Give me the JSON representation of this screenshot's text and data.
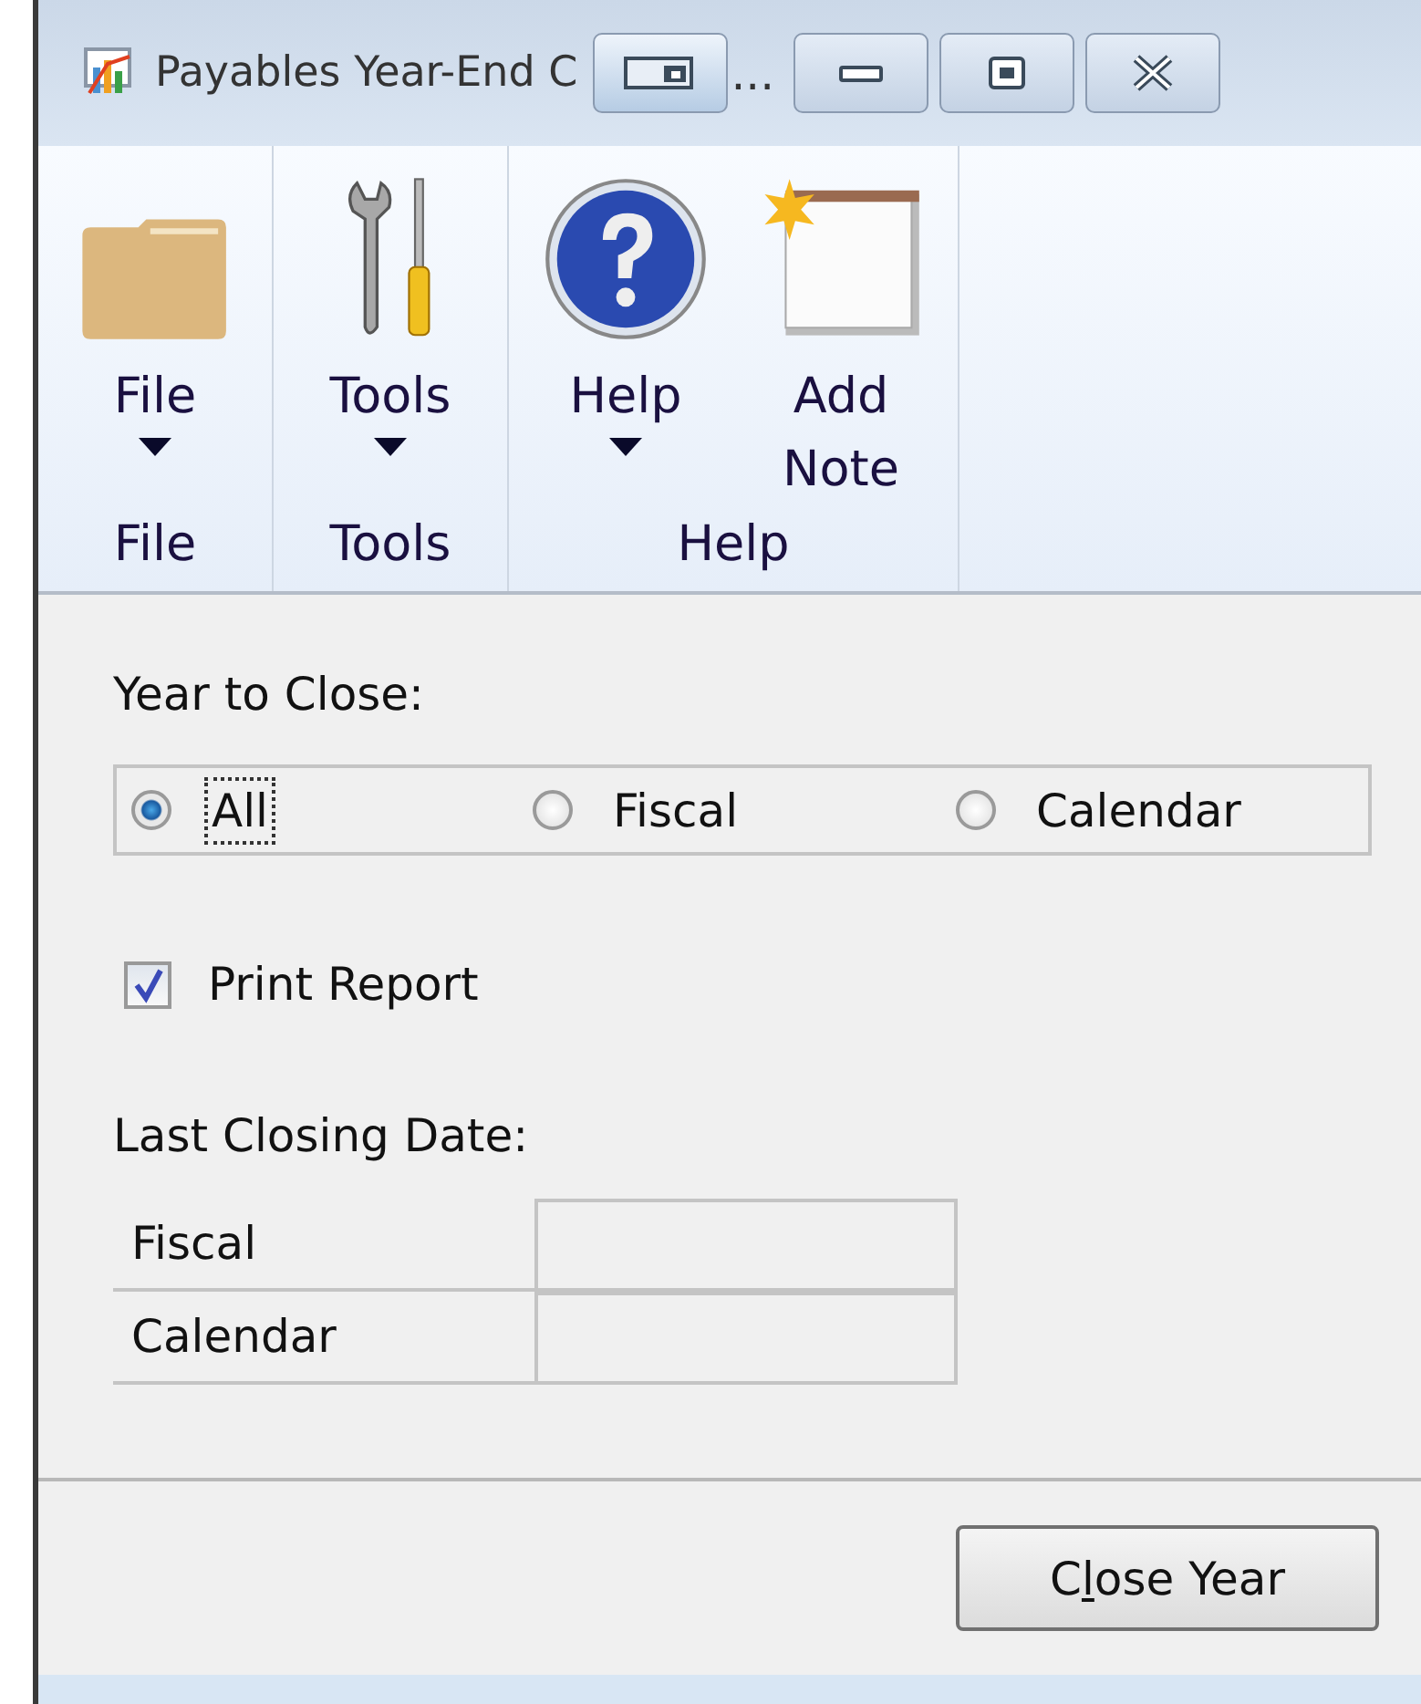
{
  "window": {
    "title": "Payables Year-End C",
    "title_tail": "..."
  },
  "ribbon": {
    "groups": [
      {
        "label": "File",
        "items": [
          {
            "kind": "folder",
            "label": "File",
            "dropdown": true
          }
        ]
      },
      {
        "label": "Tools",
        "items": [
          {
            "kind": "tools",
            "label": "Tools",
            "dropdown": true
          }
        ]
      },
      {
        "label": "Help",
        "items": [
          {
            "kind": "help",
            "label": "Help",
            "dropdown": true
          },
          {
            "kind": "note",
            "label": "Add Note",
            "dropdown": false
          }
        ]
      }
    ]
  },
  "year_to_close": {
    "label": "Year to Close:",
    "options": [
      {
        "label": "All",
        "selected": true
      },
      {
        "label": "Fiscal",
        "selected": false
      },
      {
        "label": "Calendar",
        "selected": false
      }
    ]
  },
  "print_report": {
    "label": "Print Report",
    "checked": true
  },
  "last_closing_date": {
    "label": "Last Closing Date:",
    "rows": [
      {
        "label": "Fiscal"
      },
      {
        "label": "Calendar"
      }
    ]
  },
  "close_button": {
    "label_before_key": "C",
    "access_key": "l",
    "label_after_key": "ose Year"
  }
}
